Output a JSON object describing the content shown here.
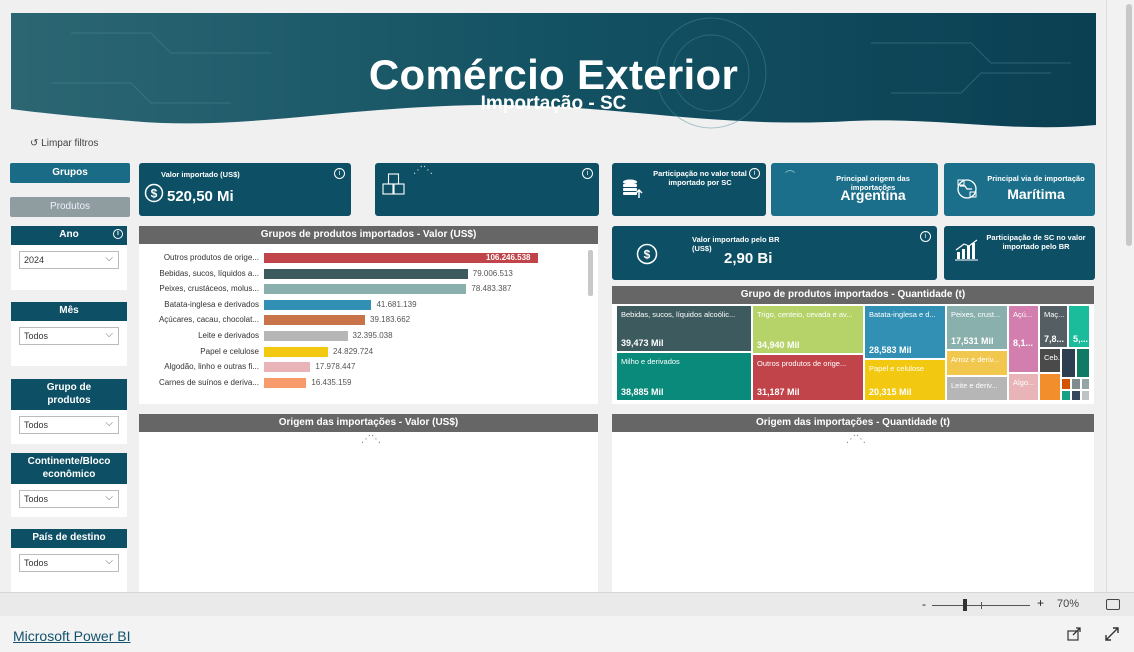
{
  "banner": {
    "title": "Comércio Exterior",
    "subtitle": "Importação - SC"
  },
  "filters": {
    "clear_label": "↺ Limpar filtros",
    "nav": {
      "grupos": "Grupos",
      "produtos": "Produtos"
    },
    "ano": {
      "label": "Ano",
      "value": "2024"
    },
    "mes": {
      "label": "Mês",
      "value": "Todos"
    },
    "grupo": {
      "label": "Grupo de produtos",
      "value": "Todos"
    },
    "continente": {
      "label": "Continente/Bloco econômico",
      "value": "Todos"
    },
    "pais": {
      "label": "País de destino",
      "value": "Todos"
    }
  },
  "kpis": {
    "valor_importado": {
      "label": "Valor importado (US$)",
      "value": "520,50 Mi"
    },
    "participacao": {
      "label": "Participação no valor total importado por SC"
    },
    "origem": {
      "label": "Principal origem das importações",
      "value": "Argentina"
    },
    "via": {
      "label": "Principal via de importação",
      "value": "Marítima"
    },
    "valor_br": {
      "label": "Valor importado pelo BR (US$)",
      "value": "2,90 Bi"
    },
    "participacao_br": {
      "label": "Participação de SC no valor importado pelo BR"
    }
  },
  "panels": {
    "bar_title": "Grupos de produtos importados - Valor (US$)",
    "treemap_title": "Grupo de produtos importados - Quantidade (t)",
    "origem_valor_title": "Origem das importações - Valor (US$)",
    "origem_qtd_title": "Origem das importações - Quantidade (t)"
  },
  "chart_data": [
    {
      "type": "bar",
      "title": "Grupos de produtos importados - Valor (US$)",
      "categories": [
        "Outros produtos de orige...",
        "Bebidas, sucos, líquidos a...",
        "Peixes, crustáceos, molus...",
        "Batata-inglesa e derivados",
        "Açúcares, cacau, chocolat...",
        "Leite e derivados",
        "Papel e celulose",
        "Algodão, linho e outras fi...",
        "Carnes de suínos e deriva..."
      ],
      "values": [
        106246538,
        79006513,
        78483387,
        41681139,
        39183662,
        32395038,
        24829724,
        17978447,
        16435159
      ],
      "value_labels": [
        "106.246.538",
        "79.006.513",
        "78.483.387",
        "41.681.139",
        "39.183.662",
        "32.395.038",
        "24.829.724",
        "17.978.447",
        "16.435.159"
      ],
      "colors": [
        "#c0444a",
        "#3d5a5e",
        "#8ab0ad",
        "#3290b4",
        "#c8734a",
        "#b6b6b6",
        "#f2c811",
        "#e8b4b8",
        "#f79a6c"
      ]
    },
    {
      "type": "treemap",
      "title": "Grupo de produtos importados - Quantidade (t)",
      "items": [
        {
          "label": "Bebidas, sucos, líquidos alcoólic...",
          "value": "39,473 Mil",
          "color": "#3d5a5e"
        },
        {
          "label": "Milho e derivados",
          "value": "38,885 Mil",
          "color": "#0a8a7a"
        },
        {
          "label": "Trigo, centeio, cevada e av...",
          "value": "34,940 Mil",
          "color": "#b6d36a"
        },
        {
          "label": "Outros produtos de orige...",
          "value": "31,187 Mil",
          "color": "#c0444a"
        },
        {
          "label": "Batata-inglesa e d...",
          "value": "28,583 Mil",
          "color": "#3290b4"
        },
        {
          "label": "Papel e celulose",
          "value": "20,315 Mil",
          "color": "#f2c811"
        },
        {
          "label": "Peixes, crust...",
          "value": "17,531 Mil",
          "color": "#8ab0ad"
        },
        {
          "label": "Arroz e deriv...",
          "value": "",
          "color": "#f2c74e"
        },
        {
          "label": "Leite e deriv...",
          "value": "",
          "color": "#b6b6b6"
        },
        {
          "label": "Açú...",
          "value": "8,1...",
          "color": "#d27fb0"
        },
        {
          "label": "Algo...",
          "value": "",
          "color": "#e8b4b8"
        },
        {
          "label": "Maç...",
          "value": "7,8...",
          "color": "#555f63"
        },
        {
          "label": "Ceb...",
          "value": "",
          "color": "#4a4a4a"
        },
        {
          "label": "",
          "value": "5,...",
          "color": "#1abc9c"
        }
      ]
    }
  ],
  "statusbar": {
    "zoom_minus": "-",
    "zoom_plus": "+",
    "zoom": "70%"
  },
  "footer": {
    "link": "Microsoft Power BI"
  }
}
